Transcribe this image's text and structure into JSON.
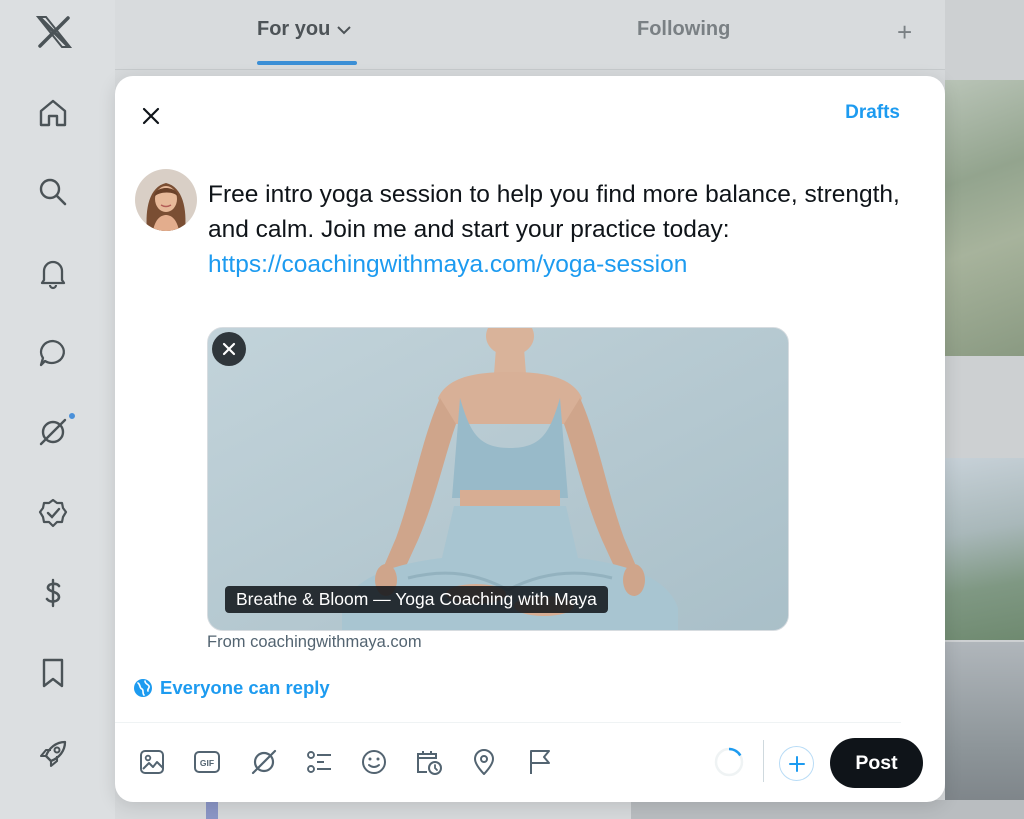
{
  "background": {
    "tabs": [
      {
        "label": "For you",
        "active": true
      },
      {
        "label": "Following",
        "active": false
      }
    ],
    "sidebar_icons": [
      "x-logo-icon",
      "home-icon",
      "search-icon",
      "notifications-bell-icon",
      "messages-icon",
      "grok-icon",
      "verified-icon",
      "monetization-icon",
      "bookmarks-icon",
      "rocket-icon"
    ]
  },
  "composer": {
    "drafts_label": "Drafts",
    "post_text": "Free intro yoga session to help you find more balance, strength, and calm. Join me and start your practice today:",
    "post_link": "https://coachingwithmaya.com/yoga-session",
    "media": {
      "caption": "Breathe & Bloom — Yoga Coaching with Maya",
      "source": "From coachingwithmaya.com"
    },
    "reply_setting": "Everyone can reply",
    "toolbar_icons": [
      "media-icon",
      "gif-icon",
      "grok-icon",
      "poll-icon",
      "emoji-icon",
      "schedule-icon",
      "location-icon",
      "flag-icon"
    ],
    "post_button": "Post",
    "colors": {
      "accent": "#1d9bf0",
      "button": "#0f1419"
    }
  }
}
